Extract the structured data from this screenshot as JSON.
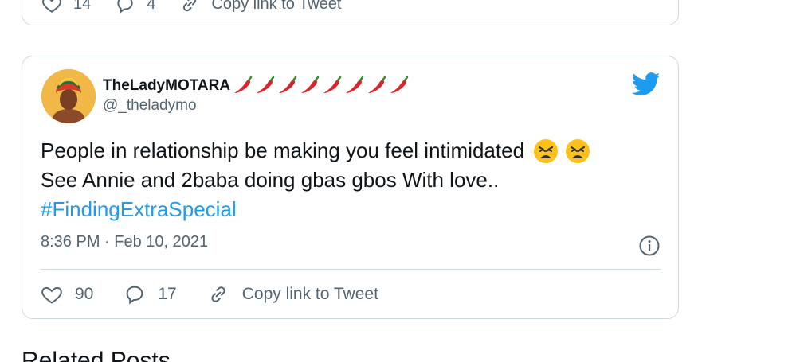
{
  "previous_tweet": {
    "likes": "14",
    "replies": "4",
    "copy_label": "Copy link to Tweet"
  },
  "tweet": {
    "display_name": "TheLadyMOTARA",
    "handle": "@_theladymo",
    "name_emoji": "hot-pepper",
    "name_emoji_count": 8,
    "text_line1": "People in relationship be making you feel intimidated",
    "text_line2": "See Annie and 2baba doing gbas gbos With love..",
    "hashtag": "#FindingExtraSpecial",
    "timestamp": "8:36 PM · Feb 10, 2021",
    "likes": "90",
    "replies": "17",
    "copy_label": "Copy link to Tweet"
  },
  "related_heading": "Related Posts",
  "colors": {
    "link": "#1d9bf0",
    "muted": "#536471",
    "border": "#cfd9de",
    "twitter_blue": "#1d9bf0"
  }
}
